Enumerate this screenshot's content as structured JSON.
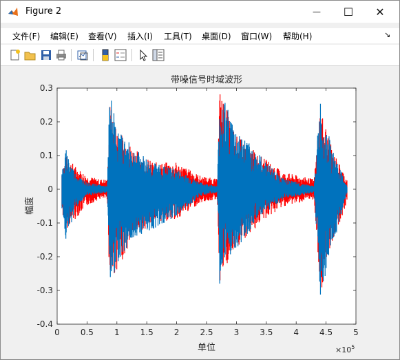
{
  "window": {
    "title": "Figure 2",
    "minimize_glyph": "—",
    "maximize_glyph": "☐",
    "close_glyph": "✕"
  },
  "menu": {
    "items": [
      "文件(F)",
      "编辑(E)",
      "查看(V)",
      "插入(I)",
      "工具(T)",
      "桌面(D)",
      "窗口(W)",
      "帮助(H)"
    ],
    "dock_glyph": "↘"
  },
  "toolbar": {
    "icons": [
      "new-figure-icon",
      "open-file-icon",
      "save-icon",
      "print-icon",
      "link-plot-icon",
      "colorbar-icon",
      "legend-icon",
      "pointer-icon",
      "property-inspector-icon"
    ]
  },
  "colors": {
    "accent_blue": "#0072BD",
    "noise_red": "#FF0000",
    "axes_bg": "#FFFFFF",
    "figure_bg": "#F0F0F0"
  },
  "chart_data": {
    "type": "line",
    "title": "带噪信号时域波形",
    "xlabel": "单位",
    "ylabel": "幅度",
    "x_multiplier_label": "×10",
    "x_multiplier_exp": "5",
    "xlim": [
      0,
      5
    ],
    "ylim": [
      -0.4,
      0.3
    ],
    "x_units": "×10^5",
    "xticks": [
      "0",
      "0.5",
      "1",
      "1.5",
      "2",
      "2.5",
      "3",
      "3.5",
      "4",
      "4.5",
      "5"
    ],
    "yticks": [
      "0.3",
      "0.2",
      "0.1",
      "0",
      "-0.1",
      "-0.2",
      "-0.3",
      "-0.4"
    ],
    "grid": false,
    "series": [
      {
        "color": "#FF0000",
        "description_of_shape": "noisy signal envelope",
        "envelope": [
          {
            "x": 0.08,
            "upper": 0.06,
            "lower": -0.07
          },
          {
            "x": 0.15,
            "upper": 0.1,
            "lower": -0.12
          },
          {
            "x": 0.3,
            "upper": 0.07,
            "lower": -0.09
          },
          {
            "x": 0.5,
            "upper": 0.04,
            "lower": -0.05
          },
          {
            "x": 0.7,
            "upper": 0.03,
            "lower": -0.03
          },
          {
            "x": 0.84,
            "upper": 0.03,
            "lower": -0.03
          },
          {
            "x": 0.88,
            "upper": 0.26,
            "lower": -0.3
          },
          {
            "x": 1.0,
            "upper": 0.18,
            "lower": -0.24
          },
          {
            "x": 1.3,
            "upper": 0.12,
            "lower": -0.14
          },
          {
            "x": 1.6,
            "upper": 0.08,
            "lower": -0.1
          },
          {
            "x": 2.0,
            "upper": 0.08,
            "lower": -0.09
          },
          {
            "x": 2.4,
            "upper": 0.04,
            "lower": -0.04
          },
          {
            "x": 2.68,
            "upper": 0.03,
            "lower": -0.03
          },
          {
            "x": 2.72,
            "upper": 0.3,
            "lower": -0.28
          },
          {
            "x": 3.0,
            "upper": 0.16,
            "lower": -0.18
          },
          {
            "x": 3.4,
            "upper": 0.1,
            "lower": -0.1
          },
          {
            "x": 3.8,
            "upper": 0.05,
            "lower": -0.05
          },
          {
            "x": 4.3,
            "upper": 0.03,
            "lower": -0.03
          },
          {
            "x": 4.4,
            "upper": 0.25,
            "lower": -0.32
          },
          {
            "x": 4.6,
            "upper": 0.12,
            "lower": -0.16
          },
          {
            "x": 4.85,
            "upper": 0.03,
            "lower": -0.04
          }
        ]
      },
      {
        "color": "#0072BD",
        "description_of_shape": "clean speech signal envelope",
        "envelope": [
          {
            "x": 0.08,
            "upper": 0.05,
            "lower": -0.06
          },
          {
            "x": 0.15,
            "upper": 0.12,
            "lower": -0.16
          },
          {
            "x": 0.3,
            "upper": 0.05,
            "lower": -0.06
          },
          {
            "x": 0.5,
            "upper": 0.02,
            "lower": -0.02
          },
          {
            "x": 0.84,
            "upper": 0.01,
            "lower": -0.01
          },
          {
            "x": 0.88,
            "upper": 0.3,
            "lower": -0.3
          },
          {
            "x": 1.0,
            "upper": 0.18,
            "lower": -0.22
          },
          {
            "x": 1.3,
            "upper": 0.12,
            "lower": -0.14
          },
          {
            "x": 1.6,
            "upper": 0.08,
            "lower": -0.12
          },
          {
            "x": 2.0,
            "upper": 0.06,
            "lower": -0.08
          },
          {
            "x": 2.4,
            "upper": 0.02,
            "lower": -0.02
          },
          {
            "x": 2.68,
            "upper": 0.01,
            "lower": -0.01
          },
          {
            "x": 2.72,
            "upper": 0.3,
            "lower": -0.28
          },
          {
            "x": 3.0,
            "upper": 0.18,
            "lower": -0.18
          },
          {
            "x": 3.4,
            "upper": 0.1,
            "lower": -0.08
          },
          {
            "x": 3.8,
            "upper": 0.03,
            "lower": -0.03
          },
          {
            "x": 4.3,
            "upper": 0.01,
            "lower": -0.01
          },
          {
            "x": 4.4,
            "upper": 0.27,
            "lower": -0.32
          },
          {
            "x": 4.6,
            "upper": 0.12,
            "lower": -0.18
          },
          {
            "x": 4.85,
            "upper": 0.01,
            "lower": -0.01
          }
        ]
      }
    ]
  }
}
